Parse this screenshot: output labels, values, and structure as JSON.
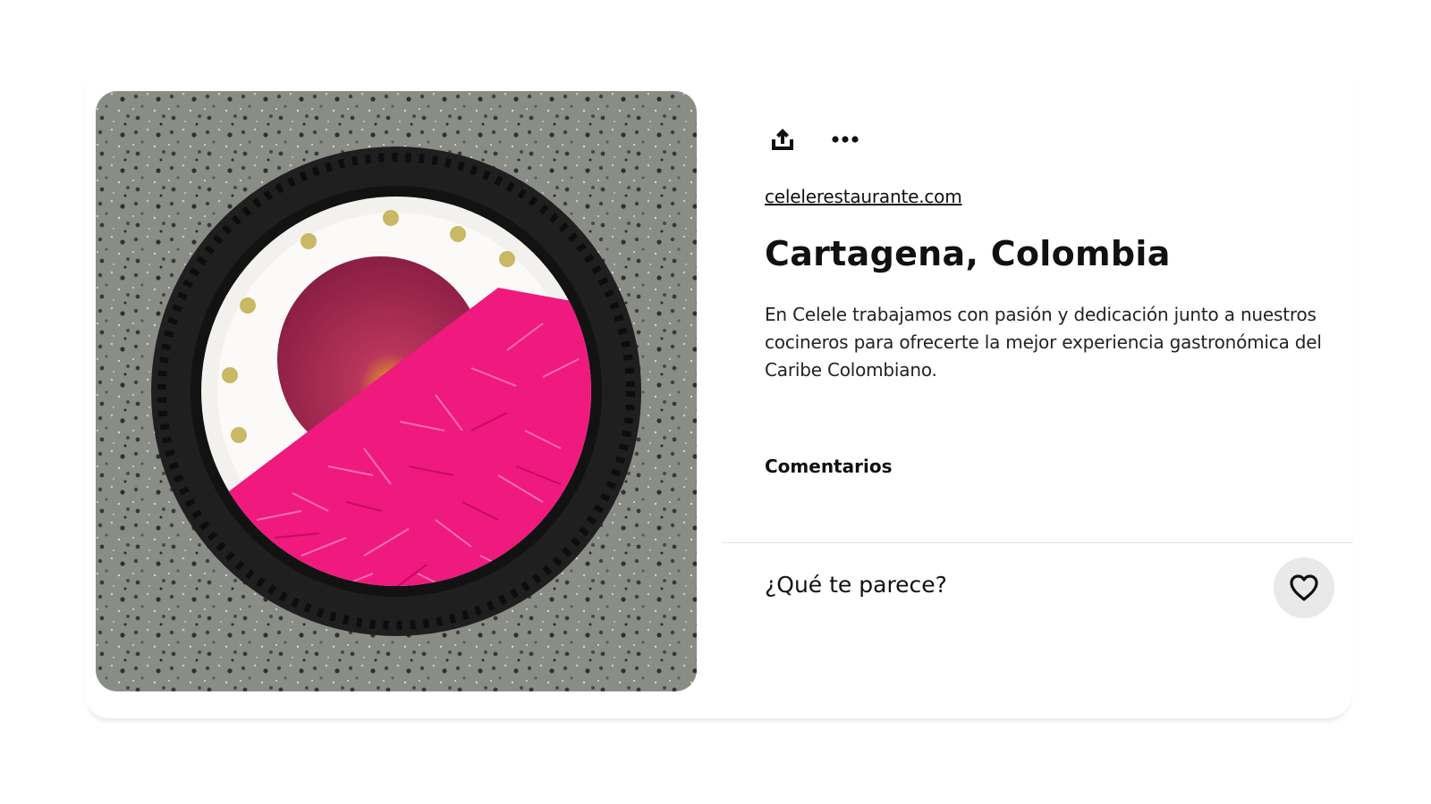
{
  "pin": {
    "image_alt": "Plated dish on a dark round plate over speckled stone",
    "source_link": "celelerestaurante.com",
    "title": "Cartagena, Colombia",
    "description": "En Celele trabajamos con pasión y dedicación junto a nuestros cocineros para ofrecerte la mejor experiencia gastronómica del Caribe Colombiano."
  },
  "toolbar": {
    "share_icon": "share-icon",
    "more_icon": "more-options-icon"
  },
  "comments": {
    "heading": "Comentarios",
    "prompt": "¿Qué te parece?",
    "like_icon": "heart-icon"
  },
  "colors": {
    "accent_pink": "#f0197d",
    "plate_dark": "#1f1f1f",
    "cream": "#f3f1ee",
    "button_gray": "#e9e9e9"
  }
}
